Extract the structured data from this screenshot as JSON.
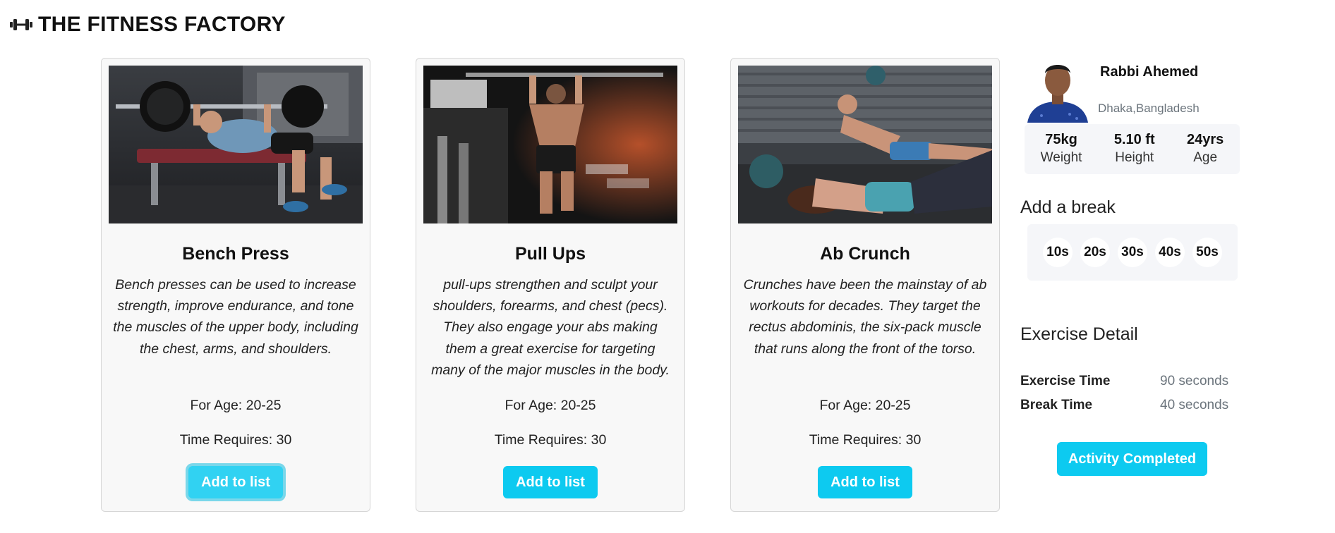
{
  "brand": {
    "title": "THE FITNESS FACTORY",
    "icon": "dumbbell-icon"
  },
  "exercises": [
    {
      "title": "Bench Press",
      "description": "Bench presses can be used to increase strength, improve endurance, and tone the muscles of the upper body, including the chest, arms, and shoulders.",
      "age": "For Age: 20-25",
      "time": "Time Requires: 30",
      "button": "Add to list"
    },
    {
      "title": "Pull Ups",
      "description": "pull-ups strengthen and sculpt your shoulders, forearms, and chest (pecs). They also engage your abs making them a great exercise for targeting many of the major muscles in the body.",
      "age": "For Age: 20-25",
      "time": "Time Requires: 30",
      "button": "Add to list"
    },
    {
      "title": "Ab Crunch",
      "description": "Crunches have been the mainstay of ab workouts for decades. They target the rectus abdominis, the six-pack muscle that runs along the front of the torso.",
      "age": "For Age: 20-25",
      "time": "Time Requires: 30",
      "button": "Add to list"
    }
  ],
  "profile": {
    "name": "Rabbi Ahemed",
    "location": "Dhaka,Bangladesh",
    "stats": [
      {
        "value": "75kg",
        "label": "Weight"
      },
      {
        "value": "5.10 ft",
        "label": "Height"
      },
      {
        "value": "24yrs",
        "label": "Age"
      }
    ]
  },
  "break": {
    "title": "Add a break",
    "options": [
      "10s",
      "20s",
      "30s",
      "40s",
      "50s"
    ]
  },
  "detail": {
    "title": "Exercise Detail",
    "exercise_label": "Exercise Time",
    "exercise_value": "90 seconds",
    "break_label": "Break Time",
    "break_value": "40 seconds"
  },
  "complete_button": "Activity Completed",
  "colors": {
    "accent": "#0dcaf0",
    "card_bg": "#f8f8f8",
    "panel_bg": "#f5f6f9"
  }
}
